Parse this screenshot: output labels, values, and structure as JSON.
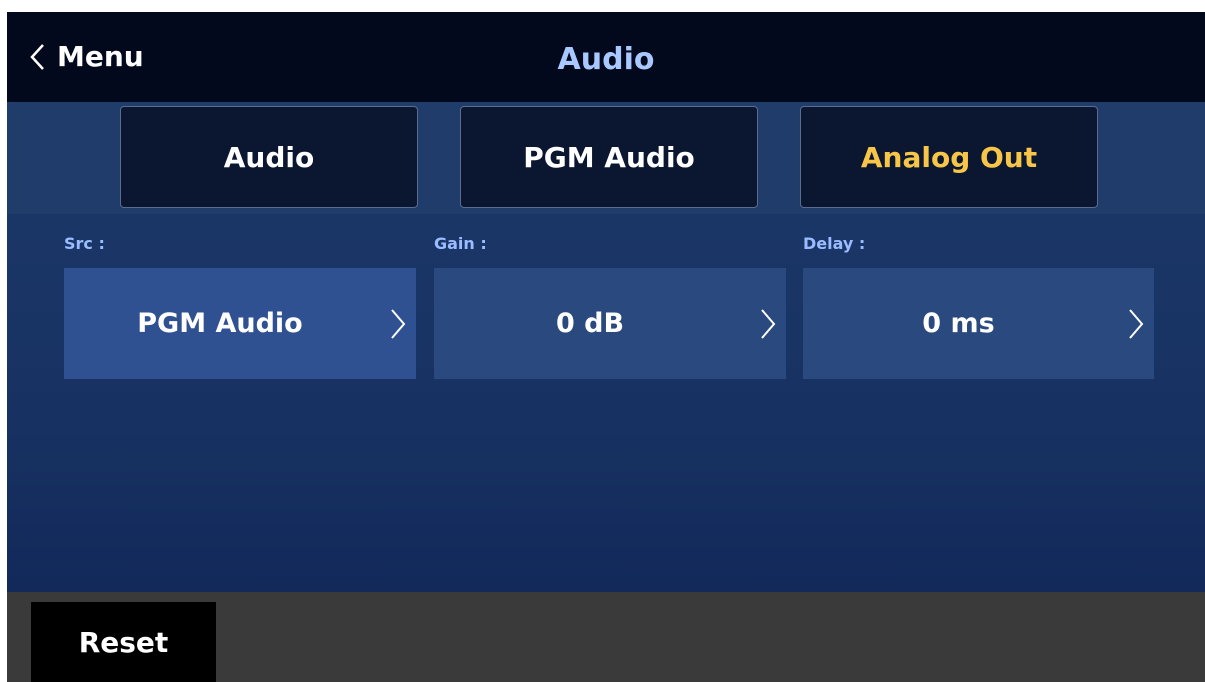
{
  "header": {
    "back_label": "Menu",
    "title": "Audio"
  },
  "tabs": [
    {
      "label": "Audio",
      "active": false
    },
    {
      "label": "PGM Audio",
      "active": false
    },
    {
      "label": "Analog Out",
      "active": true
    }
  ],
  "fields": [
    {
      "label": "Src :",
      "value": "PGM Audio",
      "selected": true
    },
    {
      "label": "Gain :",
      "value": "0 dB",
      "selected": false
    },
    {
      "label": "Delay :",
      "value": "0 ms",
      "selected": false
    }
  ],
  "footer": {
    "reset_label": "Reset"
  },
  "colors": {
    "header_bg": "#02091d",
    "title": "#a8c8ff",
    "active_tab": "#f7c548",
    "panel_bg": "#1a3667",
    "field_selected": "#2f5191",
    "field_normal": "#29497f",
    "footer_bg": "#3a3a3a"
  },
  "icons": {
    "back": "chevron-left-icon",
    "field_arrow": "chevron-right-icon"
  }
}
